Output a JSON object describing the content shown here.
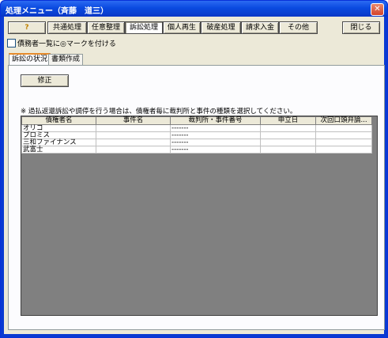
{
  "window": {
    "title": "処理メニュー（斉藤　道三）"
  },
  "toolbar": {
    "help_label": "?",
    "buttons": [
      "共通処理",
      "任意整理",
      "訴訟処理",
      "個人再生",
      "破産処理",
      "請求入金",
      "その他"
    ],
    "close_label": "閉じる"
  },
  "options": {
    "mark_checkbox_label": "債務者一覧に◎マークを付ける",
    "checked": false
  },
  "tabs": [
    "訴訟の状況",
    "書類作成"
  ],
  "panel": {
    "edit_button": "修正",
    "note": "※ 過払返還訴訟や調停を行う場合は、債権者毎に裁判所と事件の種類を選択してください。"
  },
  "table": {
    "headers": [
      "債権者名",
      "事件名",
      "裁判所・事件番号",
      "申立日",
      "次回口頭弁論..."
    ],
    "rows": [
      [
        "オリコ",
        "",
        "-------",
        "",
        ""
      ],
      [
        "プロミス",
        "",
        "-------",
        "",
        ""
      ],
      [
        "三和ファイナンス",
        "",
        "-------",
        "",
        ""
      ],
      [
        "武富士",
        "",
        "-------",
        "",
        ""
      ]
    ]
  }
}
